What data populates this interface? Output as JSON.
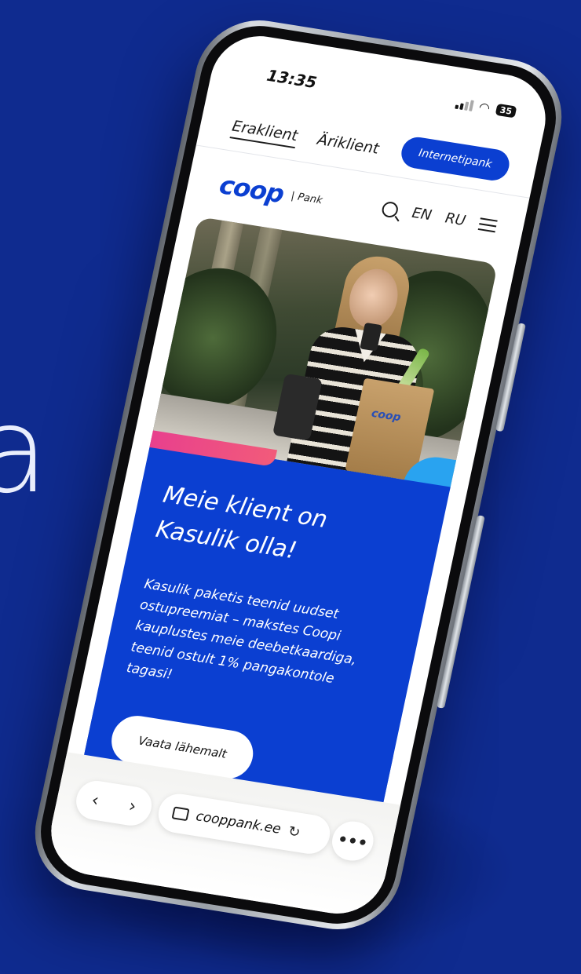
{
  "background": {
    "color": "#0f2b8f",
    "glyph": "a"
  },
  "status_bar": {
    "time": "13:35",
    "battery": "35"
  },
  "top_nav": {
    "segments": [
      {
        "label": "Eraklient",
        "active": true
      },
      {
        "label": "Äriklient",
        "active": false
      }
    ],
    "internetbank_label": "Internetipank"
  },
  "header": {
    "logo_text": "coop",
    "logo_sub": "| Pank",
    "languages": [
      "EN",
      "RU"
    ],
    "icons": [
      "search-icon",
      "menu-icon"
    ]
  },
  "hero": {
    "image_description_icon": "woman-with-coop-bag-image",
    "bag_logo": "coop"
  },
  "content": {
    "headline": "Meie klient on Kasulik olla!",
    "body": "Kasulik paketis teenid uudset ostupreemiat – makstes Coopi kauplustes meie deebetkaardiga, teenid ostult 1% pangakontole tagasi!",
    "cta_label": "Vaata lähemalt"
  },
  "browser": {
    "back": "‹",
    "forward": "›",
    "url": "cooppank.ee",
    "more": "•••"
  },
  "colors": {
    "brand_blue": "#0b3fd1",
    "accent_pink": "#e8408d",
    "accent_cyan": "#29a3f0"
  }
}
